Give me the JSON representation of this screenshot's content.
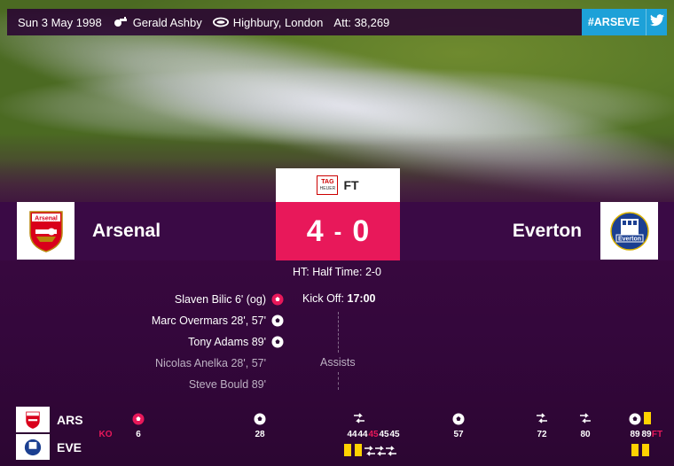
{
  "match_info": {
    "date": "Sun 3 May 1998",
    "referee": "Gerald Ashby",
    "venue": "Highbury, London",
    "attendance": "Att: 38,269",
    "hashtag": "#ARSEVE"
  },
  "status": {
    "sponsor": "TAG",
    "sponsor_sub": "HEUER",
    "label": "FT"
  },
  "home": {
    "name": "Arsenal",
    "crest_text": "Arsenal",
    "abbr": "ARS",
    "score": "4"
  },
  "away": {
    "name": "Everton",
    "crest_text": "Everton",
    "abbr": "EVE",
    "score": "0"
  },
  "score_separator": "-",
  "half_time": "HT: Half Time: 2-0",
  "kick_off": {
    "label": "Kick Off:",
    "time": "17:00"
  },
  "scorers": [
    {
      "text": "Slaven Bilic 6' (og)",
      "own_goal": true
    },
    {
      "text": "Marc Overmars 28', 57'",
      "own_goal": false
    },
    {
      "text": "Tony Adams 89'",
      "own_goal": false
    }
  ],
  "assists_label": "Assists",
  "assists": [
    {
      "text": "Nicolas Anelka 28', 57'"
    },
    {
      "text": "Steve Bould 89'"
    }
  ],
  "timeline": {
    "ko_label": "KO",
    "ft_label": "FT",
    "minute_labels": [
      "6",
      "28",
      "44",
      "44",
      "45",
      "45",
      "45",
      "57",
      "72",
      "80",
      "89",
      "89"
    ],
    "colors": {
      "accent": "#e8185a",
      "card": "#ffd200",
      "twitter": "#1da1d8",
      "band": "#3a0a45"
    }
  }
}
